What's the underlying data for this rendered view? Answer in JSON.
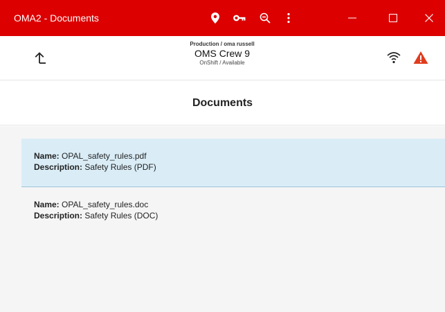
{
  "window": {
    "title": "OMA2 - Documents",
    "minimize_glyph": "—",
    "maximize_glyph": "☐",
    "close_glyph": "✕"
  },
  "toolbar_icons": [
    "location-pin-icon",
    "key-icon",
    "zoom-out-icon",
    "more-vert-icon"
  ],
  "header": {
    "context": "Production / oma russell",
    "crew_name": "OMS Crew 9",
    "status": "OnShift / Available"
  },
  "page": {
    "title": "Documents"
  },
  "documents": [
    {
      "name_label": "Name:",
      "name": " OPAL_safety_rules.pdf",
      "description_label": "Description:",
      "description": " Safety Rules (PDF)",
      "selected": true
    },
    {
      "name_label": "Name:",
      "name": " OPAL_safety_rules.doc",
      "description_label": "Description:",
      "description": " Safety Rules (DOC)",
      "selected": false
    }
  ],
  "colors": {
    "titlebar": "#dc0000",
    "selected_row": "#daedf7",
    "content_bg": "#f5f5f5",
    "alert": "#e03c1e"
  }
}
